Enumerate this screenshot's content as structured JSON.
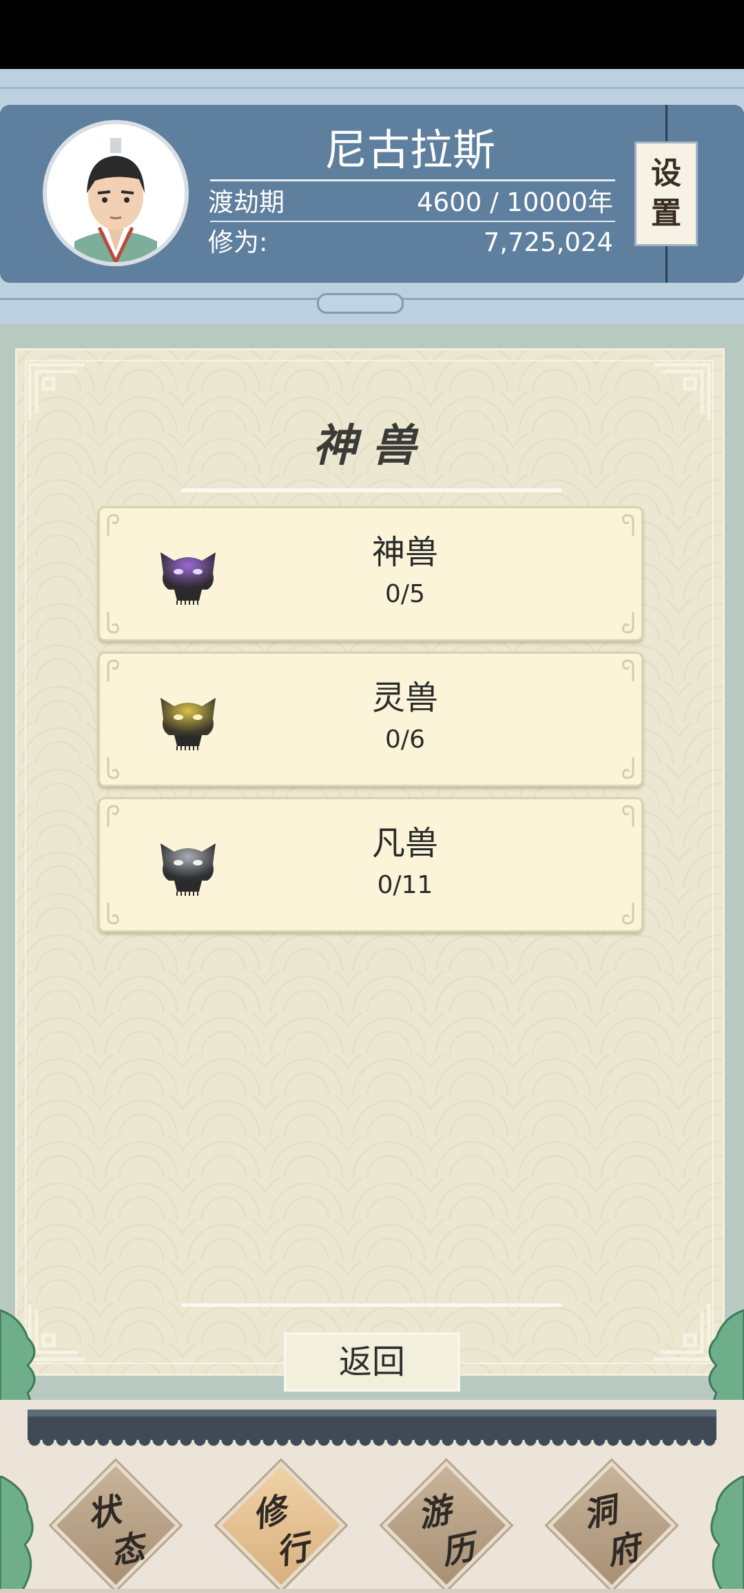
{
  "header": {
    "player_name": "尼古拉斯",
    "realm_label": "渡劫期",
    "lifespan": "4600 / 10000年",
    "cultivation_label": "修为:",
    "cultivation_value": "7,725,024",
    "settings_chars": [
      "设",
      "置"
    ]
  },
  "panel": {
    "title": "神兽",
    "cards": [
      {
        "name": "神兽",
        "count": "0/5",
        "icon": "purple-beast-mask-icon",
        "color": "#7b4fb0"
      },
      {
        "name": "灵兽",
        "count": "0/6",
        "icon": "gold-beast-mask-icon",
        "color": "#b49a2a"
      },
      {
        "name": "凡兽",
        "count": "0/11",
        "icon": "gray-beast-mask-icon",
        "color": "#6e7276"
      }
    ],
    "back_label": "返回"
  },
  "nav": {
    "items": [
      {
        "label_1": "状",
        "label_2": "态",
        "active": false
      },
      {
        "label_1": "修",
        "label_2": "行",
        "active": true
      },
      {
        "label_1": "游",
        "label_2": "历",
        "active": false
      },
      {
        "label_1": "洞",
        "label_2": "府",
        "active": false
      }
    ]
  },
  "colors": {
    "header_blue": "#5e7f9e",
    "parchment": "#ece7d0",
    "card": "#fbf4d9",
    "nav_roof": "#3f4a56"
  }
}
